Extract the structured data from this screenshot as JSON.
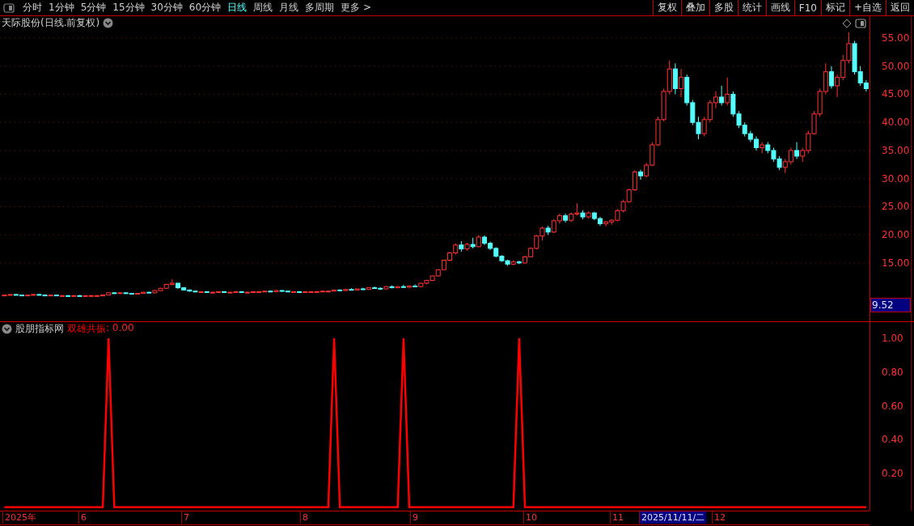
{
  "toolbar": {
    "periods": [
      {
        "label": "分时",
        "selected": false
      },
      {
        "label": "1分钟",
        "selected": false
      },
      {
        "label": "5分钟",
        "selected": false
      },
      {
        "label": "15分钟",
        "selected": false
      },
      {
        "label": "30分钟",
        "selected": false
      },
      {
        "label": "60分钟",
        "selected": false
      },
      {
        "label": "日线",
        "selected": true
      },
      {
        "label": "周线",
        "selected": false
      },
      {
        "label": "月线",
        "selected": false
      },
      {
        "label": "多周期",
        "selected": false
      },
      {
        "label": "更多 >",
        "selected": false
      }
    ],
    "actions": [
      "复权",
      "叠加",
      "多股",
      "统计",
      "画线",
      "F10",
      "标记",
      "+自选",
      "返回"
    ]
  },
  "price_panel": {
    "title": "天际股份(日线.前复权)",
    "current_price": "9.52",
    "chart_data": {
      "type": "candlestick",
      "ylim": [
        4.64,
        58.88
      ],
      "grid": true,
      "yticks": [
        {
          "value": 55,
          "label": "55.00"
        },
        {
          "value": 50,
          "label": "50.00"
        },
        {
          "value": 45,
          "label": "45.00"
        },
        {
          "value": 40,
          "label": "40.00"
        },
        {
          "value": 35,
          "label": "35.00"
        },
        {
          "value": 30,
          "label": "30.00"
        },
        {
          "value": 25,
          "label": "25.00"
        },
        {
          "value": 20,
          "label": "20.00"
        },
        {
          "value": 15,
          "label": "15.00"
        }
      ],
      "ohlc": [
        [
          9.3,
          9.4,
          9.2,
          9.3
        ],
        [
          9.3,
          9.4,
          9.2,
          9.4
        ],
        [
          9.4,
          9.5,
          9.3,
          9.3
        ],
        [
          9.3,
          9.4,
          9.2,
          9.2
        ],
        [
          9.2,
          9.4,
          9.1,
          9.3
        ],
        [
          9.3,
          9.5,
          9.2,
          9.4
        ],
        [
          9.4,
          9.5,
          9.3,
          9.3
        ],
        [
          9.3,
          9.4,
          9.1,
          9.2
        ],
        [
          9.2,
          9.3,
          9.1,
          9.3
        ],
        [
          9.3,
          9.4,
          9.2,
          9.2
        ],
        [
          9.2,
          9.3,
          9.1,
          9.2
        ],
        [
          9.2,
          9.3,
          9.0,
          9.1
        ],
        [
          9.1,
          9.3,
          9.0,
          9.2
        ],
        [
          9.2,
          9.3,
          9.1,
          9.1
        ],
        [
          9.1,
          9.2,
          9.0,
          9.2
        ],
        [
          9.2,
          9.3,
          9.1,
          9.2
        ],
        [
          9.2,
          9.3,
          9.1,
          9.2
        ],
        [
          9.2,
          9.4,
          9.1,
          9.3
        ],
        [
          9.3,
          9.8,
          9.3,
          9.7
        ],
        [
          9.7,
          9.8,
          9.5,
          9.6
        ],
        [
          9.6,
          9.8,
          9.5,
          9.7
        ],
        [
          9.7,
          9.8,
          9.5,
          9.6
        ],
        [
          9.6,
          9.7,
          9.4,
          9.5
        ],
        [
          9.5,
          9.7,
          9.4,
          9.6
        ],
        [
          9.6,
          9.9,
          9.5,
          9.8
        ],
        [
          9.8,
          9.9,
          9.6,
          9.7
        ],
        [
          9.7,
          10.2,
          9.6,
          10.1
        ],
        [
          10.1,
          10.6,
          10.0,
          10.5
        ],
        [
          10.5,
          11.3,
          10.4,
          11.2
        ],
        [
          11.2,
          12.1,
          11.0,
          11.4
        ],
        [
          11.4,
          11.5,
          10.4,
          10.6
        ],
        [
          10.6,
          10.7,
          10.1,
          10.2
        ],
        [
          10.2,
          10.3,
          9.9,
          10.0
        ],
        [
          10.0,
          10.1,
          9.8,
          9.9
        ],
        [
          9.9,
          10.0,
          9.8,
          9.9
        ],
        [
          9.9,
          10.0,
          9.8,
          9.8
        ],
        [
          9.8,
          9.9,
          9.7,
          9.8
        ],
        [
          9.8,
          9.9,
          9.7,
          9.9
        ],
        [
          9.9,
          10.0,
          9.8,
          9.8
        ],
        [
          9.8,
          9.9,
          9.7,
          9.8
        ],
        [
          9.8,
          10.0,
          9.7,
          9.9
        ],
        [
          9.9,
          10.0,
          9.8,
          9.8
        ],
        [
          9.8,
          9.9,
          9.7,
          9.8
        ],
        [
          9.8,
          9.9,
          9.7,
          9.9
        ],
        [
          9.9,
          10.0,
          9.8,
          9.9
        ],
        [
          9.9,
          10.1,
          9.8,
          10.0
        ],
        [
          10.0,
          10.1,
          9.8,
          9.9
        ],
        [
          9.9,
          10.2,
          9.8,
          10.1
        ],
        [
          10.1,
          10.2,
          9.9,
          10.0
        ],
        [
          10.0,
          10.1,
          9.8,
          9.9
        ],
        [
          9.9,
          10.0,
          9.8,
          9.9
        ],
        [
          9.9,
          10.0,
          9.8,
          9.8
        ],
        [
          9.8,
          9.9,
          9.7,
          9.9
        ],
        [
          9.9,
          10.0,
          9.8,
          9.9
        ],
        [
          9.9,
          10.0,
          9.8,
          9.9
        ],
        [
          9.9,
          10.1,
          9.8,
          10.0
        ],
        [
          10.0,
          10.1,
          9.9,
          10.0
        ],
        [
          10.0,
          10.3,
          9.9,
          10.2
        ],
        [
          10.2,
          10.3,
          10.0,
          10.1
        ],
        [
          10.1,
          10.4,
          10.0,
          10.3
        ],
        [
          10.3,
          10.5,
          10.1,
          10.2
        ],
        [
          10.2,
          10.4,
          10.1,
          10.4
        ],
        [
          10.4,
          10.6,
          10.2,
          10.3
        ],
        [
          10.3,
          10.7,
          10.2,
          10.6
        ],
        [
          10.6,
          10.8,
          10.4,
          10.5
        ],
        [
          10.5,
          10.7,
          10.3,
          10.4
        ],
        [
          10.4,
          10.9,
          10.3,
          10.8
        ],
        [
          10.8,
          11.0,
          10.5,
          10.6
        ],
        [
          10.6,
          10.9,
          10.5,
          10.8
        ],
        [
          10.8,
          11.1,
          10.6,
          10.7
        ],
        [
          10.7,
          11.0,
          10.5,
          10.9
        ],
        [
          10.9,
          11.2,
          10.7,
          10.8
        ],
        [
          10.8,
          11.5,
          10.7,
          11.4
        ],
        [
          11.4,
          12.0,
          11.2,
          11.9
        ],
        [
          11.9,
          12.8,
          11.8,
          12.7
        ],
        [
          12.7,
          13.9,
          12.6,
          13.8
        ],
        [
          13.8,
          15.6,
          13.8,
          15.5
        ],
        [
          15.5,
          17.0,
          15.3,
          16.8
        ],
        [
          16.8,
          18.5,
          16.5,
          18.2
        ],
        [
          18.2,
          18.9,
          17.0,
          17.5
        ],
        [
          17.5,
          18.6,
          17.2,
          18.3
        ],
        [
          18.3,
          19.5,
          17.6,
          17.9
        ],
        [
          17.9,
          20.0,
          17.8,
          19.6
        ],
        [
          19.6,
          19.9,
          18.2,
          18.5
        ],
        [
          18.5,
          18.8,
          17.3,
          17.6
        ],
        [
          17.6,
          17.8,
          16.0,
          16.2
        ],
        [
          16.2,
          16.4,
          15.2,
          15.4
        ],
        [
          15.4,
          15.6,
          14.5,
          14.8
        ],
        [
          14.8,
          15.5,
          14.6,
          15.2
        ],
        [
          15.2,
          15.4,
          14.8,
          15.0
        ],
        [
          15.0,
          16.3,
          14.9,
          16.1
        ],
        [
          16.1,
          17.8,
          16.0,
          17.6
        ],
        [
          17.6,
          20.0,
          17.4,
          19.8
        ],
        [
          19.8,
          21.5,
          19.0,
          21.2
        ],
        [
          21.2,
          21.6,
          20.0,
          20.5
        ],
        [
          20.5,
          22.8,
          20.3,
          22.5
        ],
        [
          22.5,
          23.8,
          22.0,
          23.4
        ],
        [
          23.4,
          23.8,
          22.2,
          22.6
        ],
        [
          22.6,
          24.0,
          22.3,
          23.7
        ],
        [
          23.7,
          25.6,
          23.4,
          23.9
        ],
        [
          23.9,
          24.4,
          22.8,
          23.2
        ],
        [
          23.2,
          24.2,
          22.9,
          23.9
        ],
        [
          23.9,
          24.1,
          22.6,
          22.9
        ],
        [
          22.9,
          23.2,
          21.6,
          22.0
        ],
        [
          22.0,
          22.5,
          21.5,
          22.3
        ],
        [
          22.3,
          22.8,
          21.8,
          22.6
        ],
        [
          22.6,
          24.6,
          22.4,
          24.3
        ],
        [
          24.3,
          26.2,
          24.0,
          25.9
        ],
        [
          25.9,
          28.2,
          25.7,
          28.0
        ],
        [
          28.0,
          31.5,
          27.8,
          31.2
        ],
        [
          31.2,
          31.6,
          29.8,
          30.5
        ],
        [
          30.5,
          32.8,
          30.2,
          32.4
        ],
        [
          32.4,
          36.5,
          32.2,
          36.0
        ],
        [
          36.0,
          41.0,
          35.8,
          40.5
        ],
        [
          40.5,
          46.0,
          40.2,
          45.5
        ],
        [
          45.5,
          51.0,
          45.0,
          49.5
        ],
        [
          49.5,
          50.5,
          45.0,
          46.0
        ],
        [
          46.0,
          49.5,
          44.5,
          48.0
        ],
        [
          48.0,
          48.5,
          43.0,
          43.5
        ],
        [
          43.5,
          44.0,
          39.5,
          40.0
        ],
        [
          40.0,
          41.0,
          37.0,
          38.0
        ],
        [
          38.0,
          41.0,
          37.5,
          40.5
        ],
        [
          40.5,
          44.0,
          40.0,
          43.5
        ],
        [
          43.5,
          45.5,
          42.5,
          44.5
        ],
        [
          44.5,
          46.5,
          43.0,
          43.5
        ],
        [
          43.5,
          48.0,
          43.0,
          45.0
        ],
        [
          45.0,
          45.5,
          41.0,
          41.5
        ],
        [
          41.5,
          42.0,
          39.0,
          39.5
        ],
        [
          39.5,
          40.0,
          37.5,
          38.0
        ],
        [
          38.0,
          38.5,
          36.5,
          37.0
        ],
        [
          37.0,
          37.5,
          35.0,
          35.5
        ],
        [
          35.5,
          36.5,
          34.5,
          36.0
        ],
        [
          36.0,
          36.5,
          34.5,
          35.0
        ],
        [
          35.0,
          35.5,
          33.0,
          33.5
        ],
        [
          33.5,
          34.0,
          31.5,
          32.0
        ],
        [
          32.0,
          33.5,
          31.0,
          33.0
        ],
        [
          33.0,
          35.5,
          32.5,
          35.0
        ],
        [
          35.0,
          36.5,
          33.5,
          34.0
        ],
        [
          34.0,
          35.5,
          33.0,
          35.0
        ],
        [
          35.0,
          38.5,
          34.5,
          38.0
        ],
        [
          38.0,
          42.0,
          37.8,
          41.5
        ],
        [
          41.5,
          46.0,
          41.0,
          45.5
        ],
        [
          45.5,
          50.5,
          45.0,
          49.0
        ],
        [
          49.0,
          50.0,
          46.0,
          46.5
        ],
        [
          46.5,
          48.5,
          44.5,
          48.0
        ],
        [
          48.0,
          52.0,
          47.5,
          51.0
        ],
        [
          51.0,
          56.0,
          50.5,
          54.0
        ],
        [
          54.0,
          54.5,
          48.5,
          49.0
        ],
        [
          49.0,
          50.0,
          46.5,
          47.0
        ],
        [
          47.0,
          47.5,
          45.5,
          46.0
        ]
      ]
    }
  },
  "indicator_panel": {
    "source": "股朋指标网",
    "reading": ": 0.00",
    "chart_data": {
      "type": "line",
      "ylim": [
        -0.02,
        1.096
      ],
      "yticks": [
        {
          "value": 1,
          "label": "1.00"
        },
        {
          "value": 0.8,
          "label": "0.80"
        },
        {
          "value": 0.6,
          "label": "0.60"
        },
        {
          "value": 0.4,
          "label": "0.40"
        },
        {
          "value": 0.2,
          "label": "0.20"
        }
      ],
      "categories": [
        null,
        null,
        null,
        null,
        null,
        null,
        null,
        null,
        null,
        null,
        null,
        null,
        null,
        null,
        null,
        null,
        null,
        null,
        null,
        null,
        null,
        null,
        null,
        null,
        null,
        null,
        null,
        null,
        null,
        null,
        null,
        null,
        null,
        null,
        null,
        null,
        null,
        null,
        null,
        null,
        null,
        null,
        null,
        null,
        null,
        null,
        null,
        null,
        null,
        null,
        null,
        null,
        null,
        null,
        null,
        null,
        null,
        null,
        null,
        null,
        null,
        null,
        null,
        null,
        null,
        null,
        null,
        null,
        null,
        null,
        null,
        null,
        null,
        null,
        null,
        null,
        null,
        null,
        null,
        null,
        null,
        null,
        null,
        null,
        null,
        null,
        null,
        null,
        null,
        null,
        null,
        null,
        null,
        null,
        null,
        null,
        null,
        null,
        null,
        null,
        null,
        null,
        null,
        null,
        null,
        null,
        null,
        null,
        null,
        null,
        null,
        null,
        null,
        null,
        null,
        null,
        null,
        null,
        null,
        null,
        null,
        null,
        null,
        null,
        null,
        null,
        null,
        null,
        null,
        null,
        null,
        null,
        null,
        null,
        null,
        null,
        null,
        null,
        null,
        null,
        null,
        null,
        null,
        null,
        null,
        null,
        null,
        null,
        null,
        null
      ],
      "series": [
        {
          "name": "双雄共振",
          "color": "#ff0000",
          "values": [
            0,
            0,
            0,
            0,
            0,
            0,
            0,
            0,
            0,
            0,
            0,
            0,
            0,
            0,
            0,
            0,
            0,
            0,
            1,
            0,
            0,
            0,
            0,
            0,
            0,
            0,
            0,
            0,
            0,
            0,
            0,
            0,
            0,
            0,
            0,
            0,
            0,
            0,
            0,
            0,
            0,
            0,
            0,
            0,
            0,
            0,
            0,
            0,
            0,
            0,
            0,
            0,
            0,
            0,
            0,
            0,
            0,
            1,
            0,
            0,
            0,
            0,
            0,
            0,
            0,
            0,
            0,
            0,
            0,
            1,
            0,
            0,
            0,
            0,
            0,
            0,
            0,
            0,
            0,
            0,
            0,
            0,
            0,
            0,
            0,
            0,
            0,
            0,
            0,
            1,
            0,
            0,
            0,
            0,
            0,
            0,
            0,
            0,
            0,
            0,
            0,
            0,
            0,
            0,
            0,
            0,
            0,
            0,
            0,
            0,
            0,
            0,
            0,
            0,
            0,
            0,
            0,
            0,
            0,
            0,
            0,
            0,
            0,
            0,
            0,
            0,
            0,
            0,
            0,
            0,
            0,
            0,
            0,
            0,
            0,
            0,
            0,
            0,
            0,
            0,
            0,
            0,
            0,
            0,
            0,
            0,
            0,
            0,
            0,
            0
          ]
        }
      ]
    }
  },
  "date_axis": [
    {
      "label": "2025年",
      "selected": false
    },
    {
      "label": "6",
      "selected": false
    },
    {
      "label": "7",
      "selected": false
    },
    {
      "label": "8",
      "selected": false
    },
    {
      "label": "9",
      "selected": false
    },
    {
      "label": "10",
      "selected": false
    },
    {
      "label": "11",
      "selected": false
    },
    {
      "label": "2025/11/11/二",
      "selected": true
    },
    {
      "label": "12",
      "selected": false
    }
  ]
}
